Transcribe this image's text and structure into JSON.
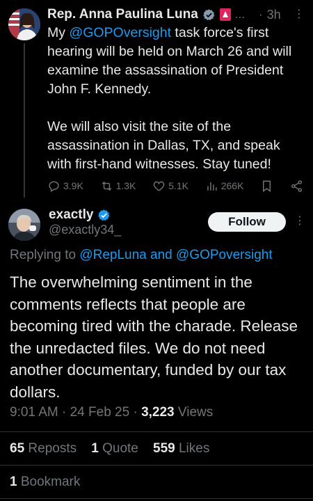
{
  "parent_tweet": {
    "author_name": "Rep. Anna Paulina Luna",
    "time": "3h",
    "ellipsis": "...",
    "text_prefix": "My ",
    "mention": "@GOPOversight",
    "text_line1_rest": " task force's first hearing will be held on March 26 and will examine the assassination of President John F. Kennedy.",
    "text_para2": "We will also visit the site of the assassination in Dallas, TX, and speak with first-hand witnesses. Stay tuned!",
    "replies": "3.9K",
    "reposts": "1.3K",
    "likes": "5.1K",
    "views": "266K"
  },
  "reply_tweet": {
    "author_name": "exactly",
    "handle": "@exactly34_",
    "follow_label": "Follow",
    "replying_prefix": "Replying to ",
    "replying_mentions": "@RepLuna and @GOPoversight",
    "text": "The overwhelming sentiment in the comments reflects that people are becoming tired with the charade. Release the unredacted files. We do not need another documentary, funded by our tax dollars.",
    "time": "9:01 AM",
    "date": "24 Feb 25",
    "views_count": "3,223",
    "views_label": " Views",
    "reposts_count": "65",
    "reposts_label": " Reposts",
    "quotes_count": "1",
    "quotes_label": " Quote",
    "likes_count": "559",
    "likes_label": " Likes",
    "bookmarks_count": "1",
    "bookmarks_label": " Bookmark"
  },
  "colors": {
    "background": "#000000",
    "text": "#e7e9ea",
    "muted": "#71767b",
    "link": "#1d9bf0",
    "verified_blue": "#1d9bf0",
    "verified_gray": "#829aab",
    "flag_red": "#e0245e"
  },
  "icons": [
    "reply-icon",
    "repost-icon",
    "like-icon",
    "views-icon",
    "bookmark-icon",
    "share-icon",
    "verified-badge-icon",
    "more-icon"
  ]
}
